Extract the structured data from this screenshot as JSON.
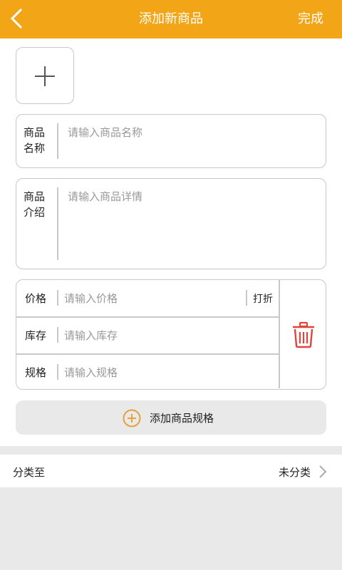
{
  "header": {
    "title": "添加新商品",
    "done_label": "完成",
    "background_color": "#f2a516"
  },
  "icons": {
    "back": "chevron-left-icon",
    "upload": "plus-icon",
    "delete": "trash-icon",
    "add_spec": "plus-circle-icon",
    "category_arrow": "chevron-right-icon"
  },
  "form": {
    "name": {
      "label": "商品名称",
      "placeholder": "请输入商品名称"
    },
    "description": {
      "label": "商品介绍",
      "placeholder": "请输入商品详情"
    },
    "spec": {
      "price_label": "价格",
      "price_placeholder": "请输入价格",
      "discount_label": "打折",
      "stock_label": "库存",
      "stock_placeholder": "请输入库存",
      "spec_label": "规格",
      "spec_placeholder": "请输入规格"
    },
    "add_spec_label": "添加商品规格"
  },
  "category": {
    "label": "分类至",
    "value": "未分类"
  },
  "colors": {
    "accent": "#f2a516",
    "delete": "#e0443a"
  }
}
